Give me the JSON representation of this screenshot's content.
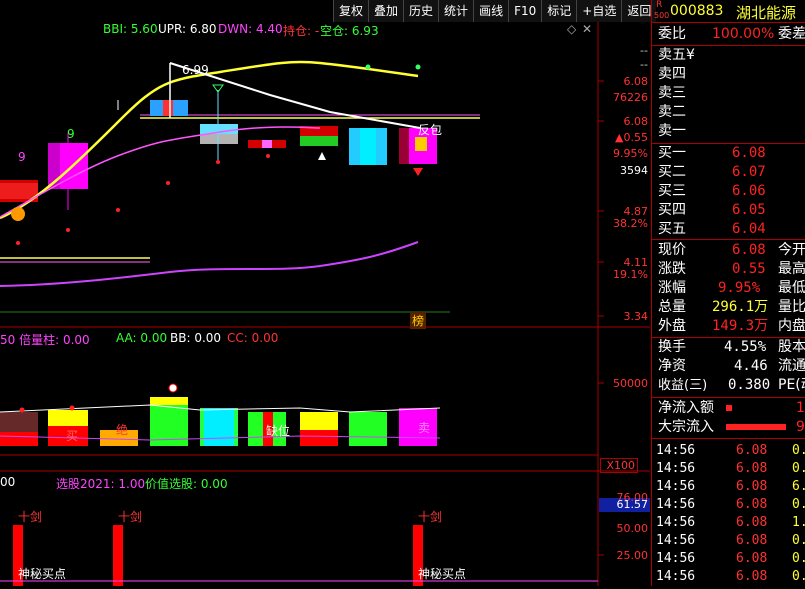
{
  "toolbar": {
    "buttons": [
      "复权",
      "叠加",
      "历史",
      "统计",
      "画线",
      "F10",
      "标记",
      "+自选",
      "返回"
    ]
  },
  "main_chart": {
    "indicator": {
      "bbi": "BBI: 5.60",
      "upr": "UPR: 6.80",
      "dwn": "DWN: 4.40",
      "hold": "持仓: -",
      "empty": "空仓: 6.93"
    },
    "peak_label": "6.99",
    "annot_left": "9",
    "annot_left2": "9",
    "annot_right": "反包",
    "ranking": "榜",
    "axis": {
      "dash1": "--",
      "dash2": "--",
      "v1": "6.08",
      "v2": "76226",
      "v3": "6.08",
      "v4": "0.55",
      "v5": "9.95%",
      "v6": "3594",
      "v7": "4.87",
      "v8": "38.2%",
      "v9": "4.11",
      "v10": "19.1%",
      "v11": "3.34"
    }
  },
  "volume_chart": {
    "labels": {
      "bei": "50 倍量柱: 0.00",
      "aa": "AA: 0.00",
      "bb": "BB: 0.00",
      "cc": "CC: 0.00"
    },
    "bar_texts": [
      "买",
      "绝",
      "缺位",
      "卖"
    ],
    "axis": {
      "v1": "50000",
      "unit": "X100"
    }
  },
  "lower_chart": {
    "labels": {
      "sel": "00",
      "sel2021": "选股2021: 1.00",
      "value": "价值选股: 0.00"
    },
    "signals": [
      "十剑",
      "十剑",
      "十剑"
    ],
    "bottom_texts": [
      "神秘买点",
      "神秘买点"
    ],
    "axis": {
      "top": "76.00",
      "current": "61.57",
      "mid": "50.00",
      "low": "25.00"
    }
  },
  "panel": {
    "code_prefix": "R",
    "code_sub": "500",
    "code": "000883",
    "name": "湖北能源",
    "weibi_label": "委比",
    "weibi": "100.00%",
    "weicha_label": "委差",
    "sells": [
      {
        "label": "卖五",
        "extra": "¥"
      },
      {
        "label": "卖四"
      },
      {
        "label": "卖三"
      },
      {
        "label": "卖二"
      },
      {
        "label": "卖一"
      }
    ],
    "buys": [
      {
        "label": "买一",
        "price": "6.08"
      },
      {
        "label": "买二",
        "price": "6.07"
      },
      {
        "label": "买三",
        "price": "6.06"
      },
      {
        "label": "买四",
        "price": "6.05"
      },
      {
        "label": "买五",
        "price": "6.04"
      }
    ],
    "quote": [
      {
        "l": "现价",
        "v": "6.08",
        "r": "今开"
      },
      {
        "l": "涨跌",
        "v": "0.55",
        "r": "最高"
      },
      {
        "l": "涨幅",
        "v": "9.95%",
        "r": "最低"
      },
      {
        "l": "总量",
        "v": "296.1万",
        "r": "量比"
      },
      {
        "l": "外盘",
        "v": "149.3万",
        "r": "内盘"
      }
    ],
    "fund": [
      {
        "l": "换手",
        "v": "4.55%",
        "r": "股本"
      },
      {
        "l": "净资",
        "v": "4.46",
        "r": "流通"
      },
      {
        "l": "收益(三)",
        "v": "0.380",
        "r": "PE(动"
      }
    ],
    "flow": [
      {
        "l": "净流入额",
        "v": "1"
      },
      {
        "l": "大宗流入",
        "v": "9"
      }
    ],
    "ticks": [
      {
        "t": "14:56",
        "p": "6.08",
        "v": "0."
      },
      {
        "t": "14:56",
        "p": "6.08",
        "v": "0."
      },
      {
        "t": "14:56",
        "p": "6.08",
        "v": "6."
      },
      {
        "t": "14:56",
        "p": "6.08",
        "v": "0."
      },
      {
        "t": "14:56",
        "p": "6.08",
        "v": "1."
      },
      {
        "t": "14:56",
        "p": "6.08",
        "v": "0."
      },
      {
        "t": "14:56",
        "p": "6.08",
        "v": "0."
      },
      {
        "t": "14:56",
        "p": "6.08",
        "v": "0."
      }
    ]
  }
}
